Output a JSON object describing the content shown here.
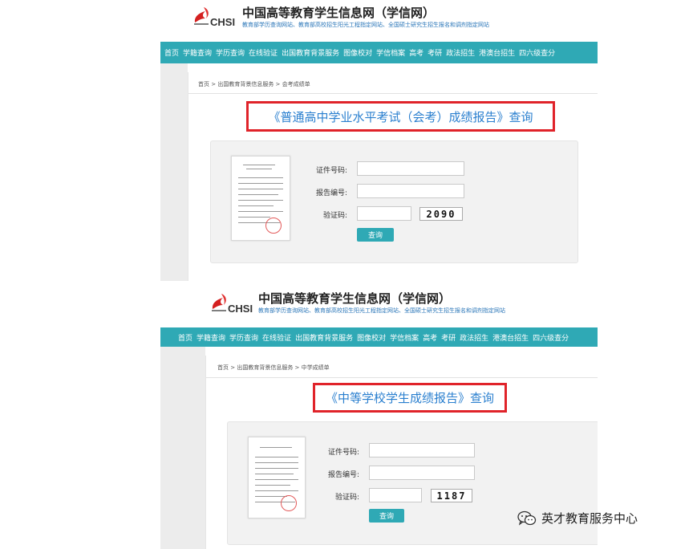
{
  "site": {
    "title": "中国高等教育学生信息网（学信网）",
    "subtitle": "教育部学历查询网站、教育部高校招生阳光工程指定网站、全国硕士研究生招生报名和调剂指定网站",
    "logo_text": "CHSI"
  },
  "nav_items": [
    "首页",
    "学籍查询",
    "学历查询",
    "在线验证",
    "出国教育背景服务",
    "图像校对",
    "学信档案",
    "高考",
    "考研",
    "政法招生",
    "港澳台招生",
    "四六级查分"
  ],
  "panel1": {
    "breadcrumb": "首页 > 出国教育背景信息服务 > 会考成绩单",
    "heading": "《普通高中学业水平考试（会考）成绩报告》查询",
    "form": {
      "cert_label": "证件号码:",
      "report_label": "报告编号:",
      "captcha_label": "验证码:",
      "captcha_value": "2090",
      "submit_label": "查询"
    }
  },
  "panel2": {
    "breadcrumb": "首页 > 出国教育背景信息服务 > 中学成绩单",
    "heading": "《中等学校学生成绩报告》查询",
    "form": {
      "cert_label": "证件号码:",
      "report_label": "报告编号:",
      "captcha_label": "验证码:",
      "captcha_value": "1187",
      "submit_label": "查询"
    }
  },
  "watermark": {
    "text": "英才教育服务中心",
    "icon": "wechat-icon"
  },
  "colors": {
    "nav_bg": "#2fa9b5",
    "highlight_border": "#e0232a",
    "heading_text": "#2a7fcf",
    "button_bg": "#2fa9b5"
  }
}
